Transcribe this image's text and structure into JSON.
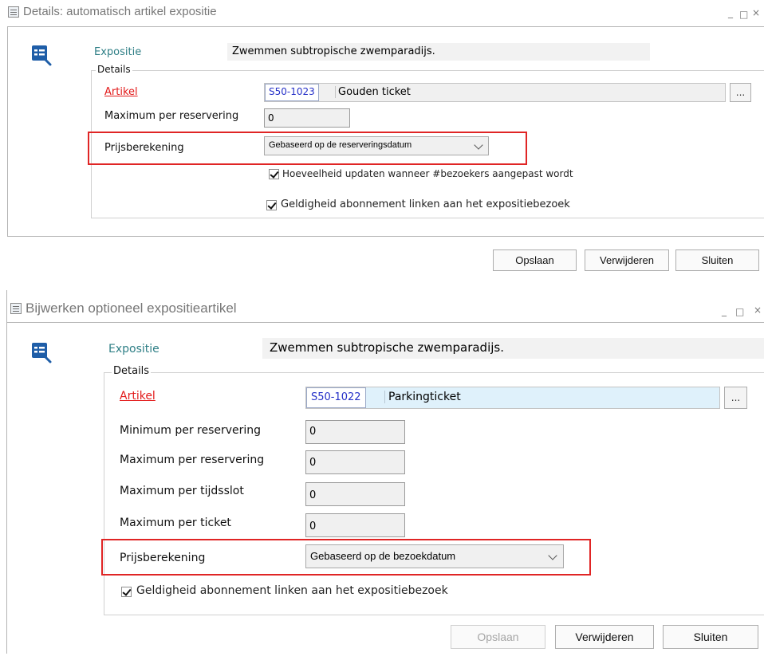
{
  "window1": {
    "title": "Details: automatisch artikel expositie",
    "minimize": "_",
    "maximize": "□",
    "close": "×",
    "exposition_label": "Expositie",
    "exposition_value": "Zwemmen subtropische zwemparadijs.",
    "details_caption": "Details",
    "article_label": "Artikel",
    "article_code": "S50-1023",
    "article_name": "Gouden ticket",
    "browse": "...",
    "max_per_reservation_label": "Maximum per reservering",
    "max_per_reservation_value": "0",
    "pricing_label": "Prijsberekening",
    "pricing_value": "Gebaseerd op de reserveringsdatum",
    "checkbox_update_label": "Hoeveelheid updaten wanneer #bezoekers aangepast wordt",
    "checkbox_validity_label": "Geldigheid abonnement linken aan het expositiebezoek",
    "save_button": "Opslaan",
    "delete_button": "Verwijderen",
    "close_button": "Sluiten"
  },
  "window2": {
    "title": "Bijwerken optioneel expositieartikel",
    "minimize": "_",
    "maximize": "□",
    "close": "×",
    "exposition_label": "Expositie",
    "exposition_value": "Zwemmen subtropische zwemparadijs.",
    "details_caption": "Details",
    "article_label": "Artikel",
    "article_code": "S50-1022",
    "article_name": "Parkingticket",
    "browse": "...",
    "min_per_reservation_label": "Minimum per reservering",
    "min_per_reservation_value": "0",
    "max_per_reservation_label": "Maximum per reservering",
    "max_per_reservation_value": "0",
    "max_per_timeslot_label": "Maximum per tijdsslot",
    "max_per_timeslot_value": "0",
    "max_per_ticket_label": "Maximum per ticket",
    "max_per_ticket_value": "0",
    "pricing_label": "Prijsberekening",
    "pricing_value": "Gebaseerd op de bezoekdatum",
    "checkbox_validity_label": "Geldigheid abonnement linken aan het expositiebezoek",
    "save_button": "Opslaan",
    "delete_button": "Verwijderen",
    "close_button": "Sluiten"
  },
  "colors": {
    "label_teal": "#2f7f86",
    "article_red": "#e21a1a",
    "code_blue": "#2530c8",
    "highlight_red": "#e02525",
    "article_field_blue": "#dff1fb"
  },
  "icons": [
    "window-icon",
    "form-edit-icon",
    "checkmark-icon",
    "chevron-down-icon"
  ]
}
